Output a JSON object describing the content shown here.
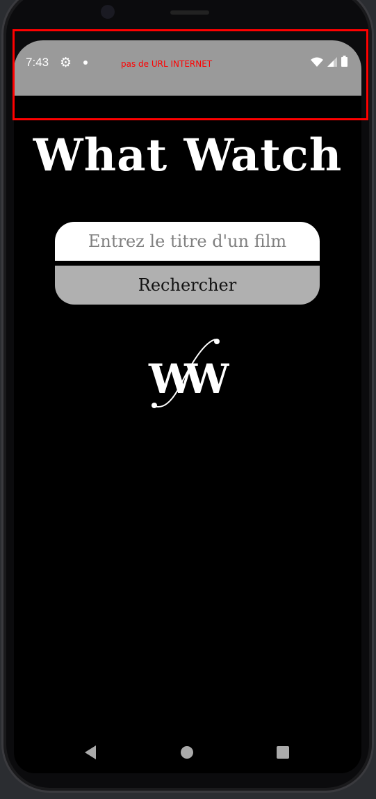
{
  "status_bar": {
    "time": "7:43",
    "warning": "pas de URL INTERNET",
    "icons": [
      "gear-icon",
      "dot-icon",
      "wifi-icon",
      "signal-icon",
      "battery-icon"
    ]
  },
  "app": {
    "title": "What Watch",
    "search_placeholder": "Entrez le titre d'un film",
    "search_button": "Rechercher",
    "logo_text": "WW"
  },
  "nav": {
    "icons": [
      "back-icon",
      "home-icon",
      "recents-icon"
    ]
  },
  "colors": {
    "status_bar": "#9a9a9a",
    "warning": "#ff0000",
    "button": "#b0b0b0",
    "background": "#000000"
  }
}
